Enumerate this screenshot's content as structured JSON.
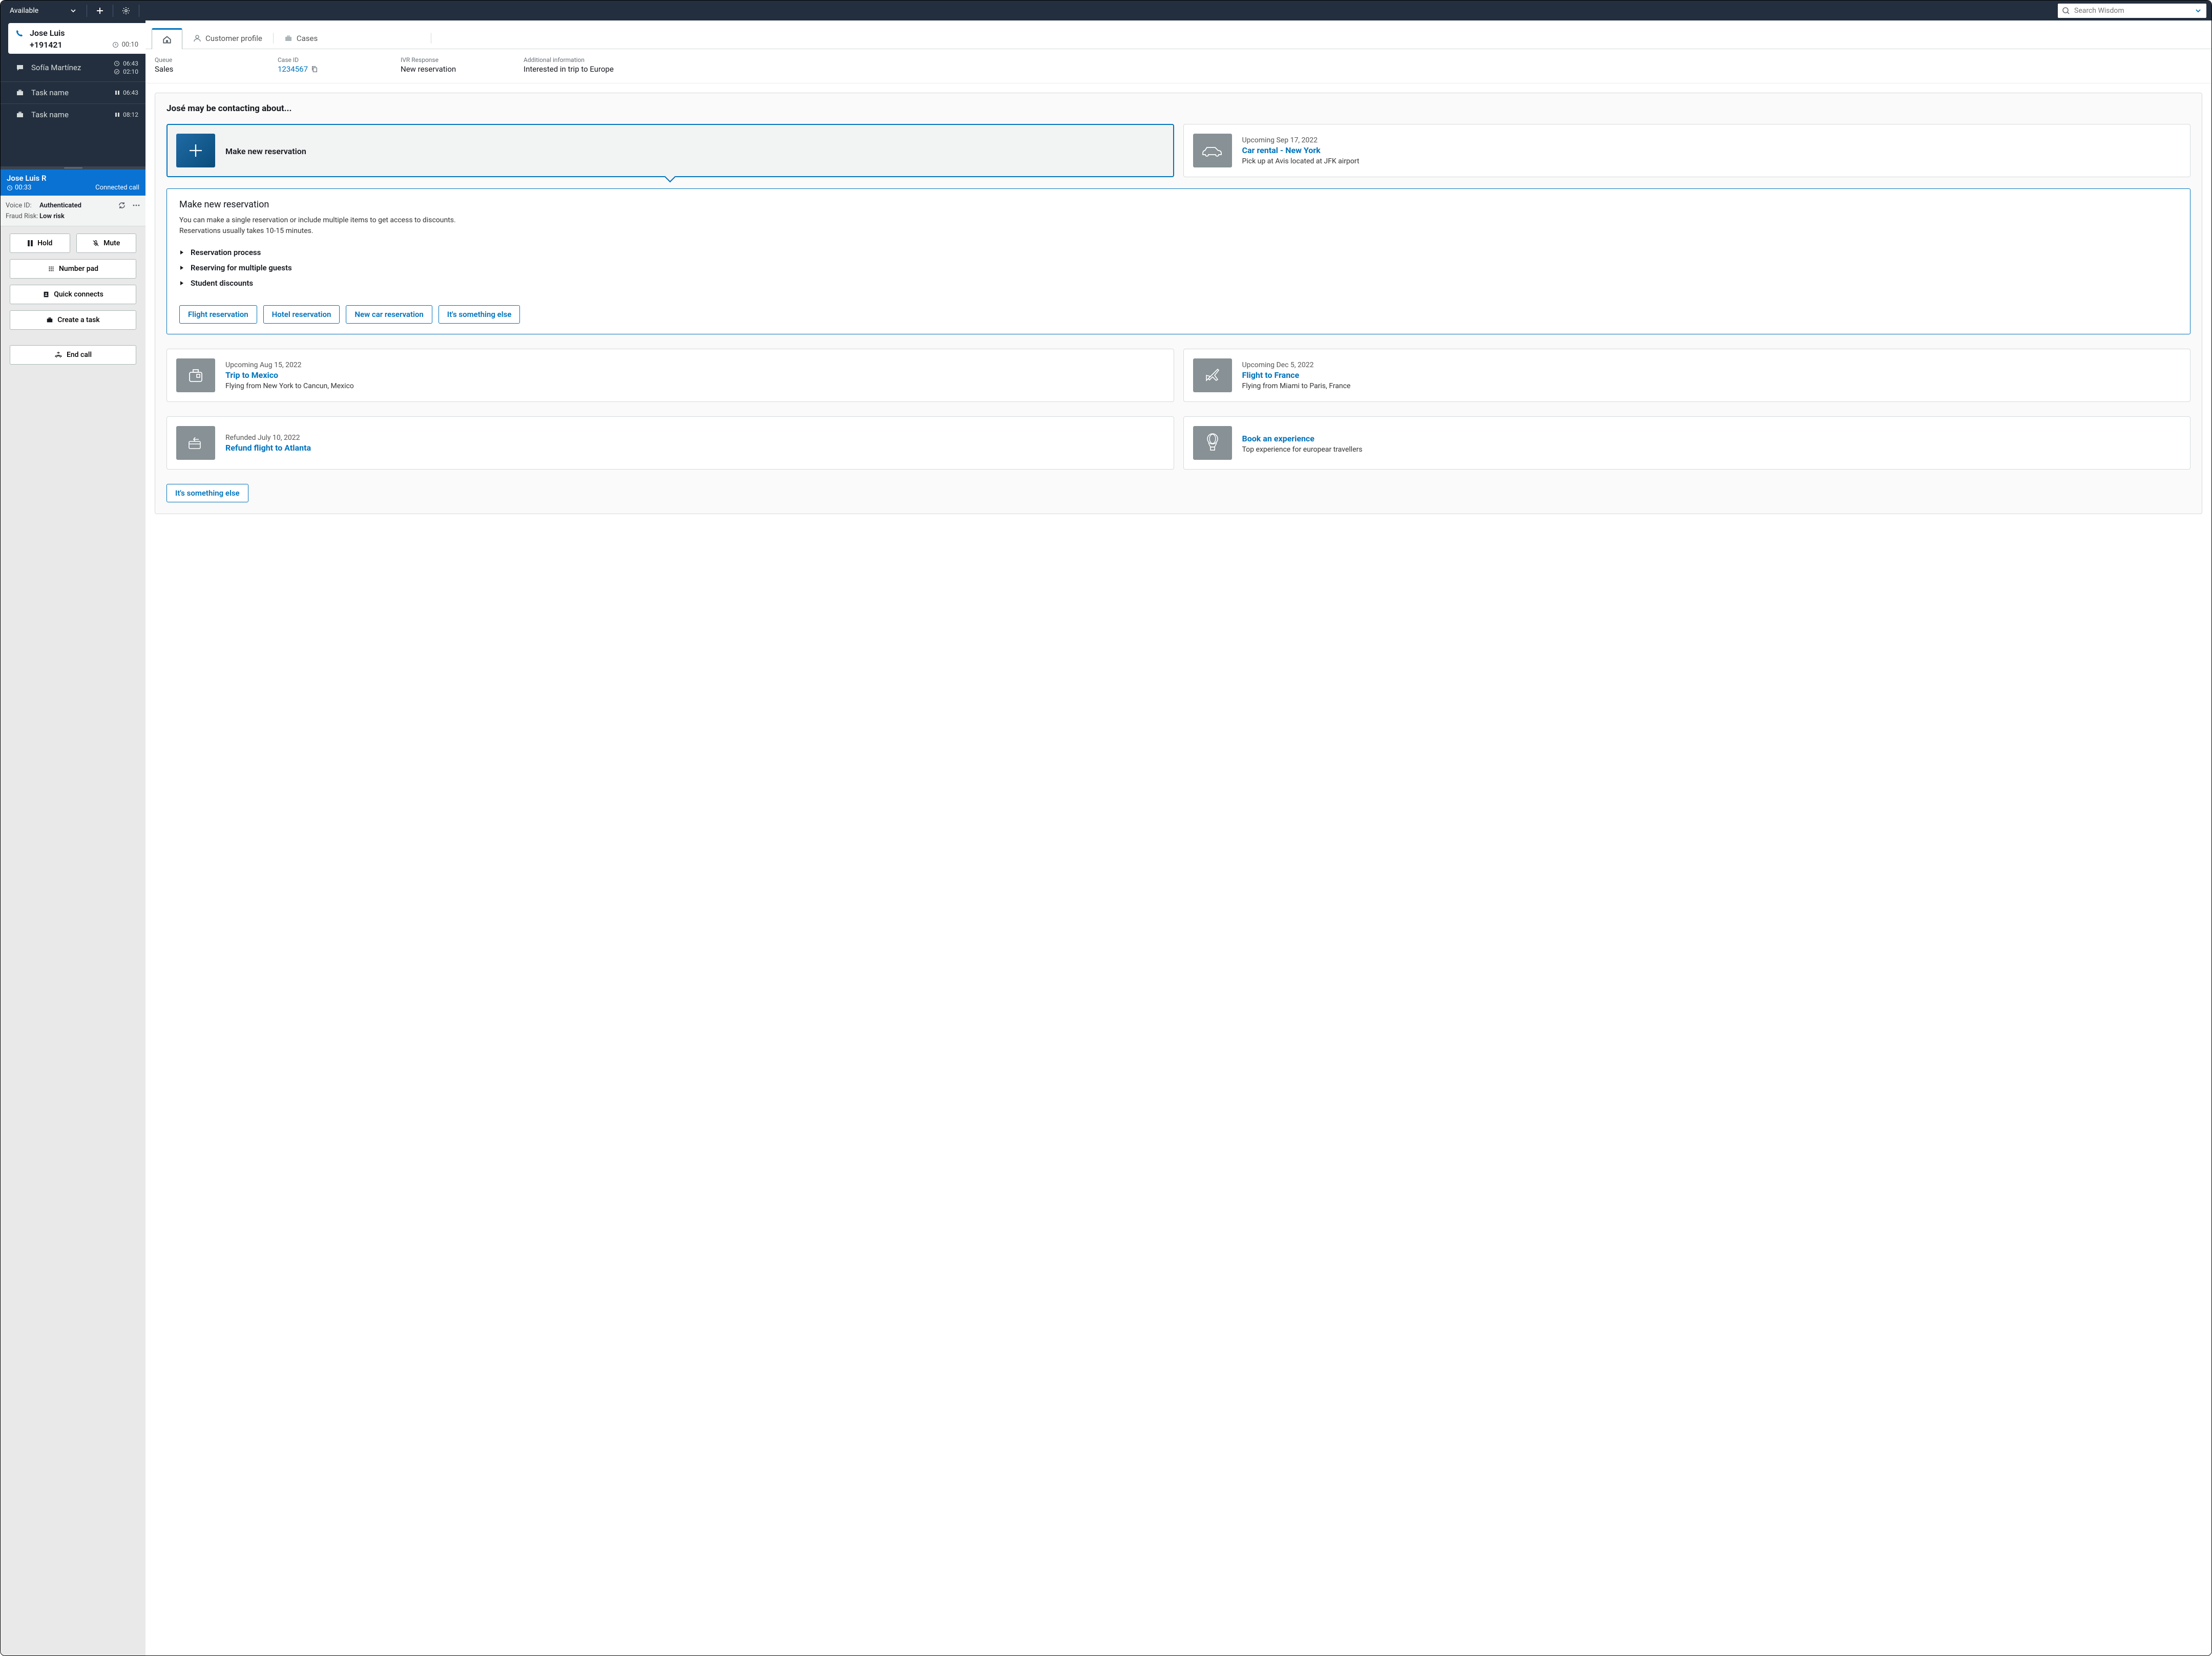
{
  "topbar": {
    "status": "Available",
    "search_placeholder": "Search Wisdom"
  },
  "sidebar": {
    "active": {
      "name": "Jose Luis",
      "phone": "+191421",
      "time": "00:10"
    },
    "items": [
      {
        "name": "Sofía Martínez",
        "t1": "06:43",
        "t2": "02:10",
        "icon": "chat"
      },
      {
        "name": "Task name",
        "t1": "06:43",
        "icon": "task",
        "state": "pause"
      },
      {
        "name": "Task name",
        "t1": "08:12",
        "icon": "task",
        "state": "pause"
      }
    ]
  },
  "call": {
    "name": "Jose Luis R",
    "time": "00:33",
    "status": "Connected call",
    "voice_id_label": "Voice ID:",
    "voice_id_value": "Authenticated",
    "fraud_label": "Fraud Risk:",
    "fraud_value": "Low risk",
    "buttons": {
      "hold": "Hold",
      "mute": "Mute",
      "numpad": "Number pad",
      "quick": "Quick connects",
      "task": "Create a task",
      "end": "End call"
    }
  },
  "tabs": {
    "profile": "Customer profile",
    "cases": "Cases"
  },
  "info": {
    "queue_l": "Queue",
    "queue_v": "Sales",
    "case_l": "Case ID",
    "case_v": "1234567",
    "ivr_l": "IVR Response",
    "ivr_v": "New reservation",
    "add_l": "Additional information",
    "add_v": "Interested in trip to Europe"
  },
  "panel": {
    "heading": "José may be contacting about...",
    "new_res": "Make new reservation",
    "car": {
      "date": "Upcoming Sep 17, 2022",
      "title": "Car rental - New York",
      "desc": "Pick up at Avis located at JFK airport"
    },
    "detail": {
      "title": "Make new reservation",
      "p1": "You can make a single reservation or include multiple items to get access to discounts.",
      "p2": "Reservations usually takes 10-15 minutes.",
      "a1": "Reservation process",
      "a2": "Reserving for multiple guests",
      "a3": "Student discounts",
      "b1": "Flight reservation",
      "b2": "Hotel reservation",
      "b3": "New car reservation",
      "b4": "It's something else"
    },
    "mex": {
      "date": "Upcoming Aug 15, 2022",
      "title": "Trip to Mexico",
      "desc": "Flying from New York to Cancun, Mexico"
    },
    "fra": {
      "date": "Upcoming Dec 5, 2022",
      "title": "Flight to France",
      "desc": "Flying from Miami to Paris, France"
    },
    "atl": {
      "date": "Refunded July 10, 2022",
      "title": "Refund flight to Atlanta"
    },
    "exp": {
      "title": "Book an experience",
      "desc": "Top experience for europear travellers"
    },
    "footer_btn": "It's something else"
  }
}
